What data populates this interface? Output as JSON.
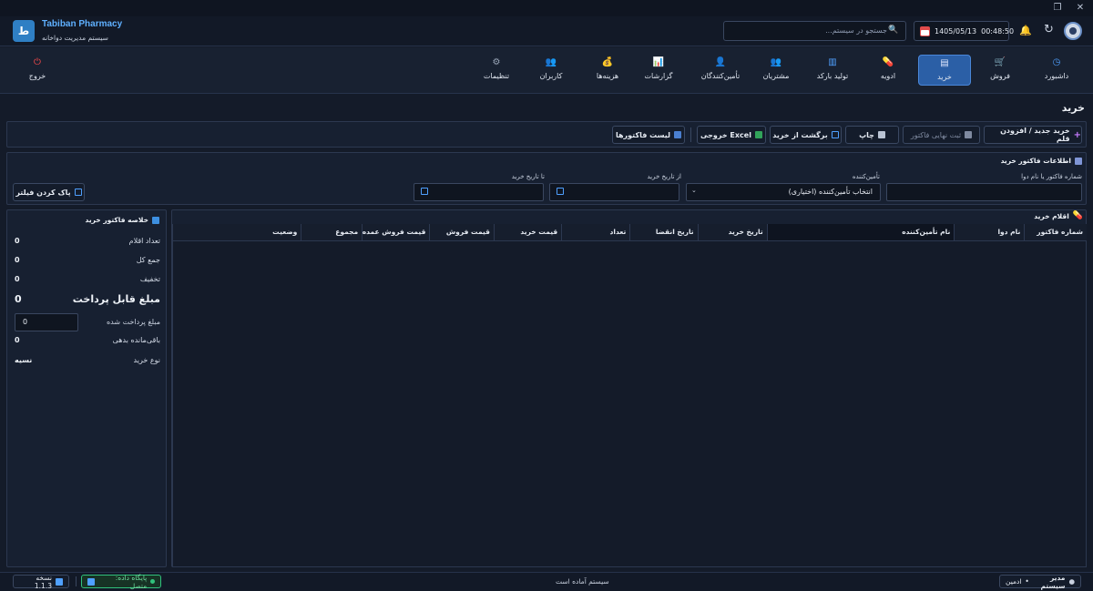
{
  "app": {
    "name": "Tabiban Pharmacy",
    "subtitle": "سیستم مدیریت دواخانه",
    "logo_letter": "ط"
  },
  "header": {
    "search_placeholder": "جستجو در سیستم...",
    "date": "1405/05/13",
    "time": "00:48:50"
  },
  "nav": [
    {
      "label": "داشبورد",
      "icon": "dashboard-icon",
      "glyph": "◷",
      "color": "#4fa0ff"
    },
    {
      "label": "فروش",
      "icon": "cart-icon",
      "glyph": "🛒",
      "color": "#31c27c"
    },
    {
      "label": "خرید",
      "icon": "purchase-icon",
      "glyph": "▤",
      "color": "#dfe7ff",
      "active": true
    },
    {
      "label": "ادویه",
      "icon": "pill-icon",
      "glyph": "💊",
      "color": "#e45a8c"
    },
    {
      "label": "تولید بارکد",
      "icon": "barcode-icon",
      "glyph": "▥",
      "color": "#4fa0ff"
    },
    {
      "label": "مشتریان",
      "icon": "customers-icon",
      "glyph": "👥",
      "color": "#f2b233"
    },
    {
      "label": "تأمین‌کنندگان",
      "icon": "suppliers-icon",
      "glyph": "👤",
      "color": "#e6a34a"
    },
    {
      "label": "گزارشات",
      "icon": "reports-icon",
      "glyph": "📊",
      "color": "#4fa0ff"
    },
    {
      "label": "هزینه‌ها",
      "icon": "moneybag-icon",
      "glyph": "💰",
      "color": "#6ac95b"
    },
    {
      "label": "کاربران",
      "icon": "users-icon",
      "glyph": "👥",
      "color": "#f2b233"
    },
    {
      "label": "تنظیمات",
      "icon": "gear-icon",
      "glyph": "⚙",
      "color": "#9aa6b8"
    },
    {
      "label": "خروج",
      "icon": "power-icon",
      "glyph": "⏻",
      "color": "#ff4b4b"
    }
  ],
  "page": {
    "title": "خرید"
  },
  "toolbar": {
    "new_invoice": "خرید جدید / افزودن قلم",
    "finalize": "ثبت نهایی فاکتور",
    "print": "چاپ",
    "return": "برگشت از خرید",
    "excel": "Excel خروجی",
    "invoice_list": "لیست فاکتورها"
  },
  "filters": {
    "section_title": "اطلاعات فاکتور خرید",
    "search_label": "شماره فاکتور یا نام دوا",
    "supplier_label": "تأمین‌کننده",
    "supplier_value": "انتخاب تأمین‌کننده (اختیاری)",
    "from_label": "از تاریخ خرید",
    "to_label": "تا تاریخ خرید",
    "clear_button": "پاک کردن فیلتر"
  },
  "summary": {
    "title": "خلاصه فاکتور خرید",
    "item_count_label": "تعداد اقلام",
    "item_count": "0",
    "total_label": "جمع کل",
    "total": "0",
    "discount_label": "تخفیف",
    "discount": "0",
    "payable_label": "مبلغ قابل پرداخت",
    "payable": "0",
    "paid_label": "مبلغ پرداخت شده",
    "paid_value": "0",
    "remaining_label": "باقی‌مانده بدهی",
    "remaining": "0",
    "type_label": "نوع خرید",
    "type_value": "نسیه"
  },
  "items": {
    "title": "اقلام خرید",
    "columns": [
      "شماره فاکتور",
      "نام دوا",
      "نام تأمین‌کننده",
      "تاریخ خرید",
      "تاریخ انقضا",
      "تعداد",
      "قیمت خرید",
      "قیمت فروش",
      "قیمت فروش عمده",
      "مجموع",
      "وضعیت"
    ]
  },
  "status": {
    "user": "مدیر سیستم",
    "role": "ادمین",
    "message": "سیستم آماده است",
    "db": "پایگاه داده: متصل",
    "version": "نسخه 1.1.3"
  },
  "colors": {
    "accent": "#2b5fa6",
    "background": "#141b29",
    "panel": "#172031",
    "success": "#31c27c"
  }
}
